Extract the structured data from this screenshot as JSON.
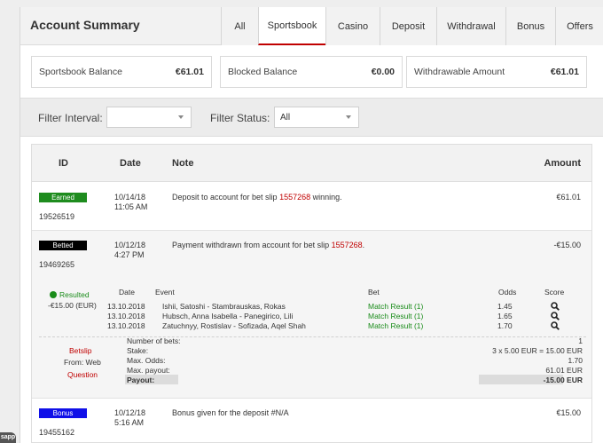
{
  "header": {
    "title": "Account Summary"
  },
  "tabs": [
    {
      "label": "All"
    },
    {
      "label": "Sportsbook",
      "active": true
    },
    {
      "label": "Casino"
    },
    {
      "label": "Deposit"
    },
    {
      "label": "Withdrawal"
    },
    {
      "label": "Bonus"
    },
    {
      "label": "Offers"
    }
  ],
  "balances": [
    {
      "label": "Sportsbook Balance",
      "value": "€61.01"
    },
    {
      "label": "Blocked Balance",
      "value": "€0.00"
    },
    {
      "label": "Withdrawable Amount",
      "value": "€61.01"
    }
  ],
  "filters": {
    "interval_label": "Filter Interval:",
    "interval_value": "",
    "status_label": "Filter Status:",
    "status_value": "All"
  },
  "table": {
    "columns": {
      "id": "ID",
      "date": "Date",
      "note": "Note",
      "amount": "Amount"
    },
    "rows": [
      {
        "status": "Earned",
        "status_color": "#1e8c1e",
        "id": "19526519",
        "date": "10/14/18",
        "time": "11:05 AM",
        "note_prefix": "Deposit to account for bet slip ",
        "note_link": "1557268",
        "note_suffix": " winning.",
        "amount": "€61.01"
      },
      {
        "status": "Betted",
        "status_color": "#000000",
        "id": "19469265",
        "date": "10/12/18",
        "time": "4:27 PM",
        "note_prefix": "Payment withdrawn from account for bet slip ",
        "note_link": "1557268",
        "note_suffix": ".",
        "amount": "-€15.00"
      },
      {
        "status": "Bonus",
        "status_color": "#1010e8",
        "id": "19455162",
        "date": "10/12/18",
        "time": "5:16 AM",
        "note_prefix": "Bonus given for the deposit #N/A",
        "note_link": "",
        "note_suffix": "",
        "amount": "€15.00"
      }
    ]
  },
  "betslip": {
    "result_status": "Resulted",
    "result_amount": "-€15.00 (EUR)",
    "columns": {
      "date": "Date",
      "event": "Event",
      "bet": "Bet",
      "odds": "Odds",
      "score": "Score"
    },
    "selections": [
      {
        "date": "13.10.2018",
        "event": "Ishii, Satoshi - Stambrauskas, Rokas",
        "bet": "Match Result (1)",
        "odds": "1.45"
      },
      {
        "date": "13.10.2018",
        "event": "Hubsch, Anna Isabella - Panegirico, Lili",
        "bet": "Match Result (1)",
        "odds": "1.65"
      },
      {
        "date": "13.10.2018",
        "event": "Zatuchnyy, Rostislav - Sofizada, Aqel Shah",
        "bet": "Match Result (1)",
        "odds": "1.70"
      }
    ],
    "links": {
      "betslip": "Betslip",
      "from": "From: Web",
      "question": "Question"
    },
    "summary": [
      {
        "label": "Number of bets:",
        "value": "1"
      },
      {
        "label": "Stake:",
        "value": "3 x 5.00 EUR = 15.00 EUR"
      },
      {
        "label": "Max. Odds:",
        "value": "1.70"
      },
      {
        "label": "Max. payout:",
        "value": "61.01 EUR"
      },
      {
        "label": "Payout:",
        "value": "-15.00 EUR"
      }
    ]
  },
  "app_badge": "sapp",
  "colors": {
    "accent": "#c00000",
    "win": "#1a8c1a"
  }
}
